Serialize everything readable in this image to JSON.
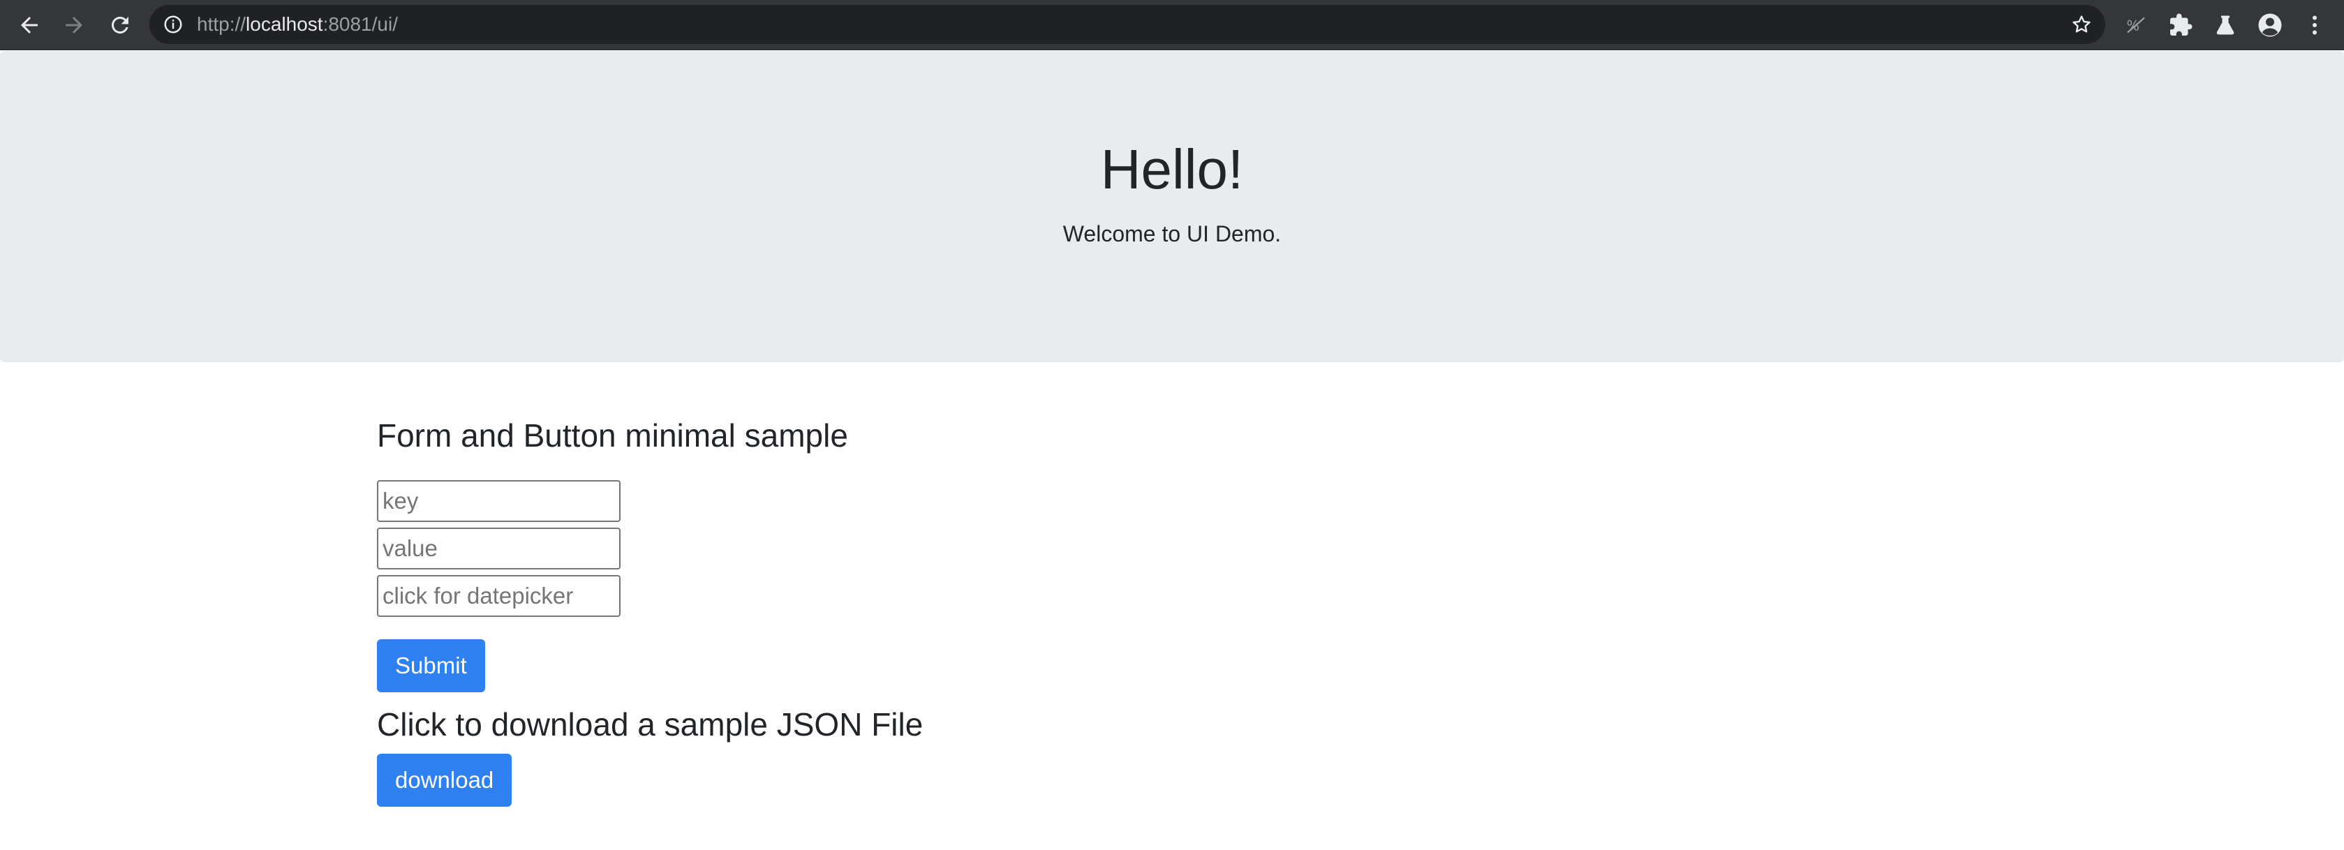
{
  "browser": {
    "url_scheme": "http://",
    "url_host": "localhost",
    "url_rest": ":8081/ui/",
    "icons": [
      "back-arrow-icon",
      "forward-arrow-icon",
      "reload-icon",
      "site-info-icon",
      "bookmark-star-icon",
      "extension-icon",
      "puzzle-icon",
      "flask-icon",
      "profile-avatar-icon",
      "kebab-menu-icon"
    ]
  },
  "jumbotron": {
    "title": "Hello!",
    "subtitle": "Welcome to UI Demo."
  },
  "form_section": {
    "heading": "Form and Button minimal sample",
    "key_placeholder": "key",
    "value_placeholder": "value",
    "date_placeholder": "click for datepicker",
    "submit_label": "Submit"
  },
  "download_section": {
    "heading": "Click to download a sample JSON File",
    "download_label": "download"
  },
  "colors": {
    "chrome_bg": "#35363a",
    "omnibox_bg": "#202124",
    "jumbotron_bg": "#e9ecef",
    "primary": "#2f80f0"
  }
}
